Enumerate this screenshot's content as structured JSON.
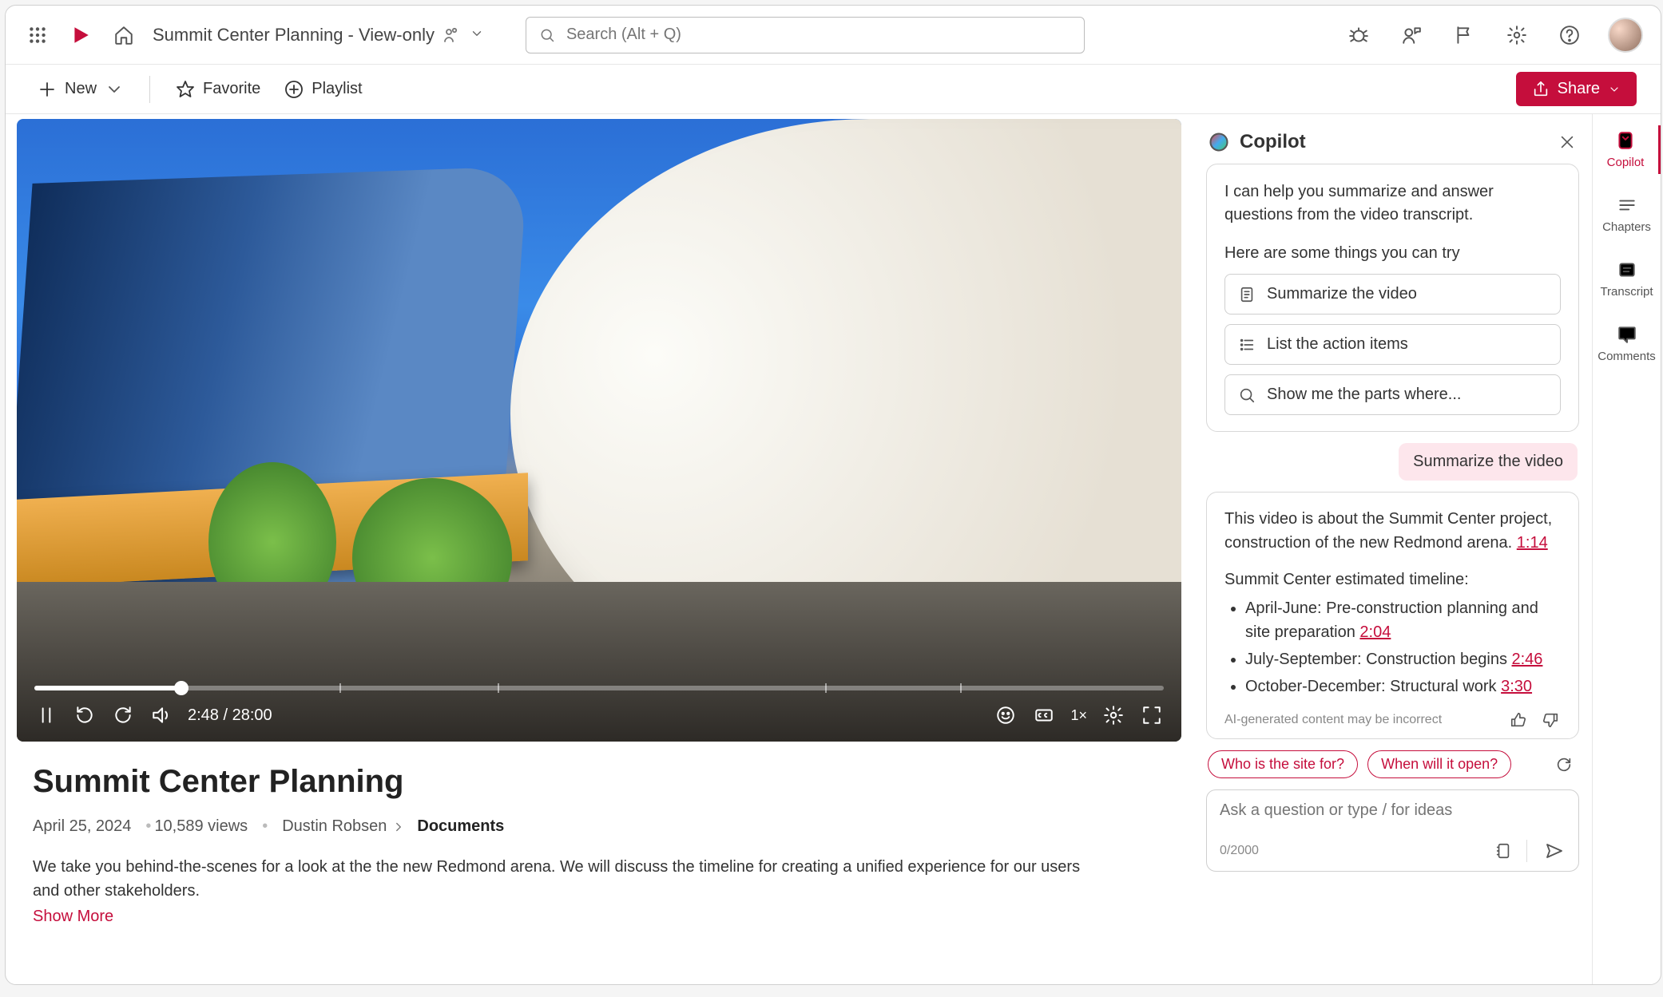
{
  "topbar": {
    "doc_title": "Summit Center Planning - View-only",
    "search_placeholder": "Search (Alt + Q)"
  },
  "cmdbar": {
    "new": "New",
    "favorite": "Favorite",
    "playlist": "Playlist",
    "share": "Share"
  },
  "player": {
    "time": "2:48 / 28:00",
    "speed": "1×",
    "progress_pct": 13,
    "ticks_pct": [
      27,
      41,
      70,
      82
    ]
  },
  "meta": {
    "title": "Summit Center Planning",
    "date": "April 25, 2024",
    "views": "10,589 views",
    "author": "Dustin Robsen",
    "breadcrumb": "Documents",
    "description": "We take you behind-the-scenes for a look at the the new Redmond arena. We will discuss the timeline for creating a unified experience for our users and other stakeholders.",
    "show_more": "Show More"
  },
  "copilot": {
    "title": "Copilot",
    "intro": "I can help you summarize and answer questions from the video transcript.",
    "subhead": "Here are some things you can try",
    "suggestions": {
      "summarize": "Summarize the video",
      "actions": "List the action items",
      "show_parts": "Show me the parts where..."
    },
    "user_message": "Summarize the video",
    "response": {
      "lead": "This video is about the Summit Center project, construction of the new Redmond arena. ",
      "lead_ts": "1:14",
      "timeline_head": "Summit Center estimated timeline:",
      "items": [
        {
          "text": "April-June: Pre-construction planning and site preparation ",
          "ts": "2:04"
        },
        {
          "text": "July-September: Construction begins ",
          "ts": "2:46"
        },
        {
          "text": "October-December: Structural work ",
          "ts": "3:30"
        }
      ],
      "disclaimer": "AI-generated content may be incorrect"
    },
    "chips": {
      "who": "Who is the site for?",
      "when": "When will it open?"
    },
    "ask_placeholder": "Ask a question or type / for ideas",
    "charcount": "0/2000"
  },
  "rail": {
    "copilot": "Copilot",
    "chapters": "Chapters",
    "transcript": "Transcript",
    "comments": "Comments"
  },
  "colors": {
    "brand": "#c50e3c"
  }
}
